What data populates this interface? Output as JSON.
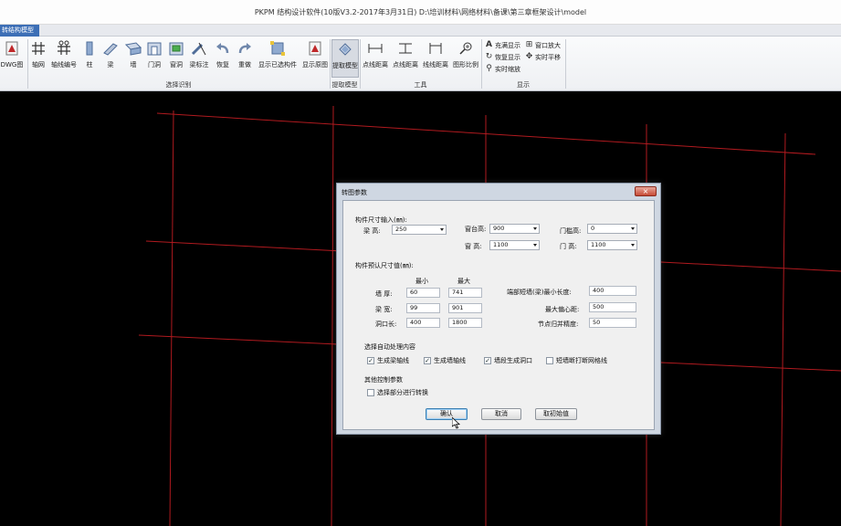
{
  "window": {
    "title": "PKPM 结构设计软件(10版V3.2-2017年3月31日)  D:\\培训材料\\网络材料\\备课\\第三章框架设计\\model"
  },
  "tabs": [
    {
      "label": "转结构模型"
    }
  ],
  "ribbon": {
    "buttons": [
      {
        "label": "DWG图",
        "icon": "dwg-icon"
      },
      {
        "label": "轴网",
        "icon": "grid-icon"
      },
      {
        "label": "轴线编号",
        "icon": "axis-number-icon"
      },
      {
        "label": "柱",
        "icon": "column-icon"
      },
      {
        "label": "梁",
        "icon": "beam-icon"
      },
      {
        "label": "墙",
        "icon": "wall-icon"
      },
      {
        "label": "门洞",
        "icon": "door-icon"
      },
      {
        "label": "窗洞",
        "icon": "window-icon"
      },
      {
        "label": "梁标注",
        "icon": "beam-annotation-icon"
      },
      {
        "label": "恢复",
        "icon": "undo-icon"
      },
      {
        "label": "重做",
        "icon": "redo-icon"
      },
      {
        "label": "显示已选构件",
        "icon": "show-selected-icon"
      },
      {
        "label": "显示原图",
        "icon": "show-original-icon"
      },
      {
        "label": "提取模型",
        "icon": "extract-model-icon"
      },
      {
        "label": "点线距离",
        "icon": "point-line-distance-icon"
      },
      {
        "label": "点线距离",
        "icon": "point-line-distance-2-icon"
      },
      {
        "label": "线线距离",
        "icon": "line-line-distance-icon"
      },
      {
        "label": "图形比例",
        "icon": "graphic-scale-icon"
      }
    ],
    "small_buttons": [
      {
        "label": "充满显示",
        "icon": "fill-display-icon"
      },
      {
        "label": "窗口放大",
        "icon": "window-zoom-icon"
      },
      {
        "label": "恢复显示",
        "icon": "restore-display-icon"
      },
      {
        "label": "实时平移",
        "icon": "realtime-pan-icon"
      },
      {
        "label": "实时缩放",
        "icon": "realtime-zoom-icon"
      }
    ],
    "groups": [
      {
        "label": "选择识别"
      },
      {
        "label": "提取模型"
      },
      {
        "label": "工具"
      },
      {
        "label": "显示"
      }
    ]
  },
  "dialog": {
    "title": "转图参数",
    "close": "×",
    "size_input": {
      "heading": "构件尺寸输入(㎜):",
      "beam_height_label": "梁  高:",
      "beam_height": "250",
      "sill_height_label": "窗台高:",
      "sill_height": "900",
      "lintel_height_label": "门槛高:",
      "lintel_height": "0",
      "window_height_label": "窗  高:",
      "window_height": "1100",
      "door_height_label": "门  高:",
      "door_height": "1100"
    },
    "size_recognition": {
      "heading": "构件预认尺寸值(㎜):",
      "min_label": "最小",
      "max_label": "最大",
      "wall_thickness_label": "墙  厚:",
      "wall_thickness_min": "60",
      "wall_thickness_max": "741",
      "beam_width_label": "梁  宽:",
      "beam_width_min": "99",
      "beam_width_max": "901",
      "opening_length_label": "洞口长:",
      "opening_length_min": "400",
      "opening_length_max": "1800",
      "edge_min_length_label": "端部短墙(梁)最小长度:",
      "edge_min_length": "400",
      "max_offset_label": "最大偏心距:",
      "max_offset": "500",
      "node_merge_label": "节点归并精度:",
      "node_merge": "50"
    },
    "auto_process": {
      "heading": "选择自动处理内容",
      "options": [
        {
          "label": "生成梁轴线",
          "checked": true
        },
        {
          "label": "生成墙轴线",
          "checked": true
        },
        {
          "label": "墙段生成洞口",
          "checked": true
        },
        {
          "label": "短墙断打断网格线",
          "checked": false
        }
      ]
    },
    "other": {
      "heading": "其他控制参数",
      "options": [
        {
          "label": "选择部分进行转换",
          "checked": false
        }
      ]
    },
    "buttons": {
      "ok": "确认",
      "cancel": "取消",
      "custom": "取初始值"
    }
  },
  "colors": {
    "canvas": "#000000",
    "grid_line": "#b01a1f",
    "tab_active": "#3d6fb6"
  }
}
